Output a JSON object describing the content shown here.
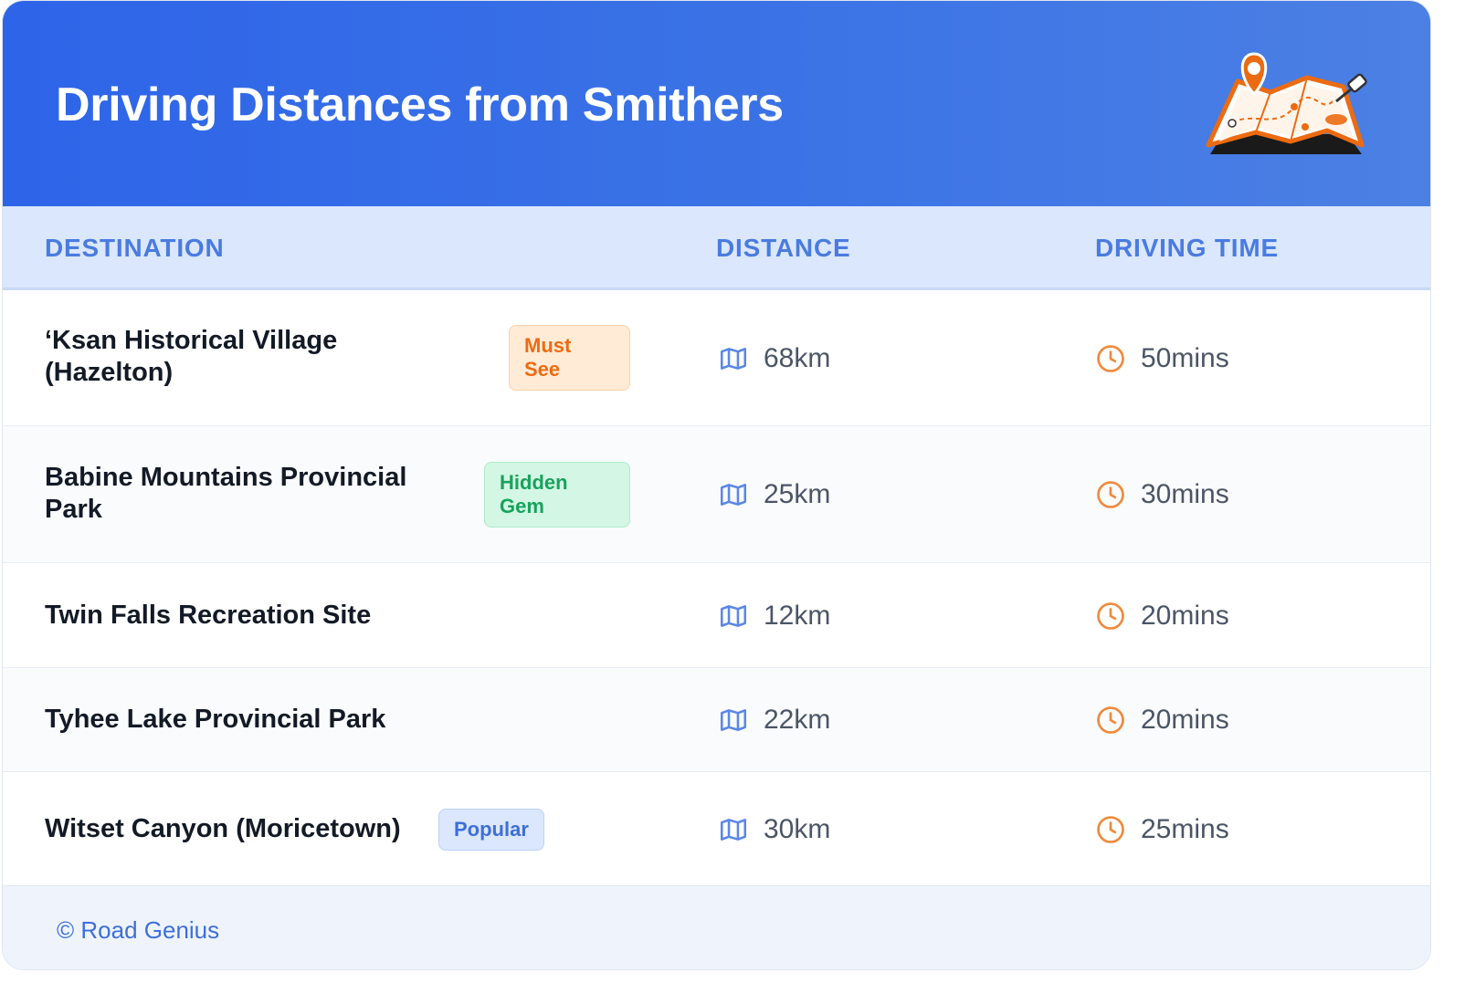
{
  "header": {
    "title": "Driving Distances from Smithers",
    "illustration": "map-with-pins-icon"
  },
  "table": {
    "columns": [
      "DESTINATION",
      "DISTANCE",
      "DRIVING TIME"
    ],
    "rows": [
      {
        "destination_line1": "‘Ksan Historical Village",
        "destination_line2": "(Hazelton)",
        "badge_line1": "Must",
        "badge_line2": "See",
        "badge_color": "orange",
        "distance": "68km",
        "time": "50mins"
      },
      {
        "destination_line1": "Babine Mountains Provincial",
        "destination_line2": "Park",
        "badge_line1": "Hidden",
        "badge_line2": "Gem",
        "badge_color": "green",
        "distance": "25km",
        "time": "30mins"
      },
      {
        "destination": "Twin Falls Recreation Site",
        "distance": "12km",
        "time": "20mins"
      },
      {
        "destination": "Tyhee Lake Provincial Park",
        "distance": "22km",
        "time": "20mins"
      },
      {
        "destination": "Witset Canyon (Moricetown)",
        "badge": "Popular",
        "badge_color": "blue",
        "distance": "30km",
        "time": "25mins"
      }
    ],
    "distance_icon": "map-icon",
    "time_icon": "clock-icon"
  },
  "footer": {
    "credit": "© Road Genius"
  },
  "colors": {
    "header_start": "#2e64e8",
    "header_end": "#4c80e4",
    "column_header_text": "#4a7be0",
    "map_icon": "#5b87e6",
    "clock_icon": "#f08a3c"
  }
}
